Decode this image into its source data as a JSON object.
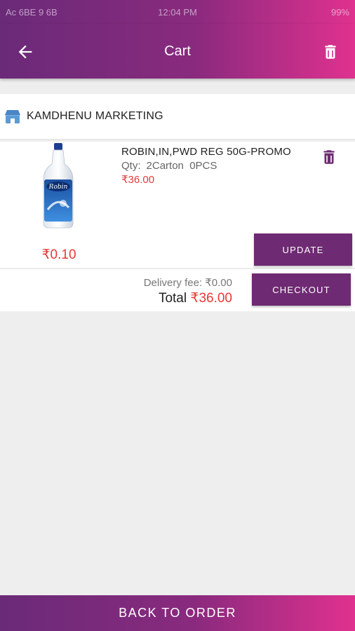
{
  "status_bar": {
    "left": "Ac 6BE 9 6B",
    "center": "12:04 PM",
    "right": "99%"
  },
  "app_bar": {
    "title": "Cart",
    "back_icon": "arrow-left-icon",
    "delete_all_icon": "trash-icon"
  },
  "seller": {
    "icon": "store-icon",
    "name": "KAMDHENU MARKETING"
  },
  "cart_item": {
    "name": "ROBIN,IN,PWD REG 50G-PROMO",
    "qty_label": "Qty:",
    "qty_value": "2Carton  0PCS",
    "price": "₹36.00",
    "unit_price": "₹0.10",
    "image_text": "Robin",
    "update_label": "UPDATE",
    "delete_icon": "trash-icon"
  },
  "summary": {
    "delivery_fee": "Delivery fee: ₹0.00",
    "total_label": "Total",
    "total_value": "₹36.00",
    "checkout_label": "CHECKOUT"
  },
  "bottom_bar": {
    "label": "BACK TO ORDER"
  },
  "colors": {
    "gradient_start": "#6a2a78",
    "gradient_end": "#e0318f",
    "button_purple": "#6e2a72",
    "price_red": "#e53935"
  }
}
